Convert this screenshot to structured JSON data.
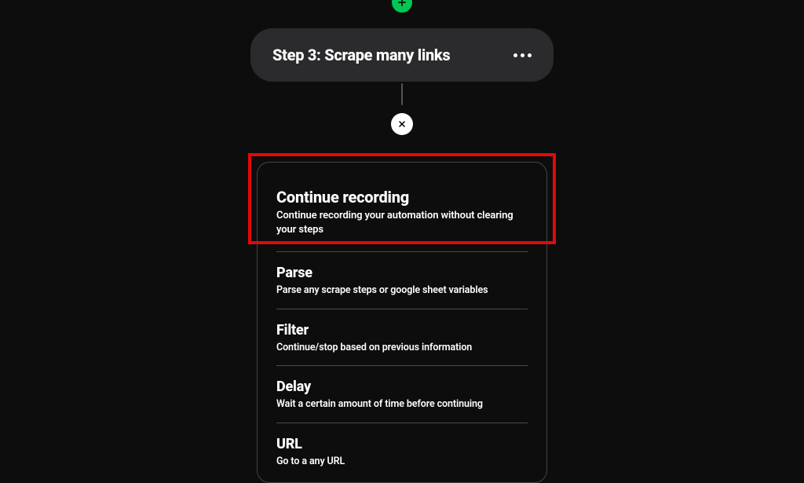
{
  "step": {
    "title": "Step 3: Scrape many links"
  },
  "menu": {
    "items": [
      {
        "title": "Continue recording",
        "desc": "Continue recording your automation without clearing your steps"
      },
      {
        "title": "Parse",
        "desc": "Parse any scrape steps or google sheet variables"
      },
      {
        "title": "Filter",
        "desc": "Continue/stop based on previous information"
      },
      {
        "title": "Delay",
        "desc": "Wait a certain amount of time before continuing"
      },
      {
        "title": "URL",
        "desc": "Go to a any URL"
      }
    ]
  }
}
